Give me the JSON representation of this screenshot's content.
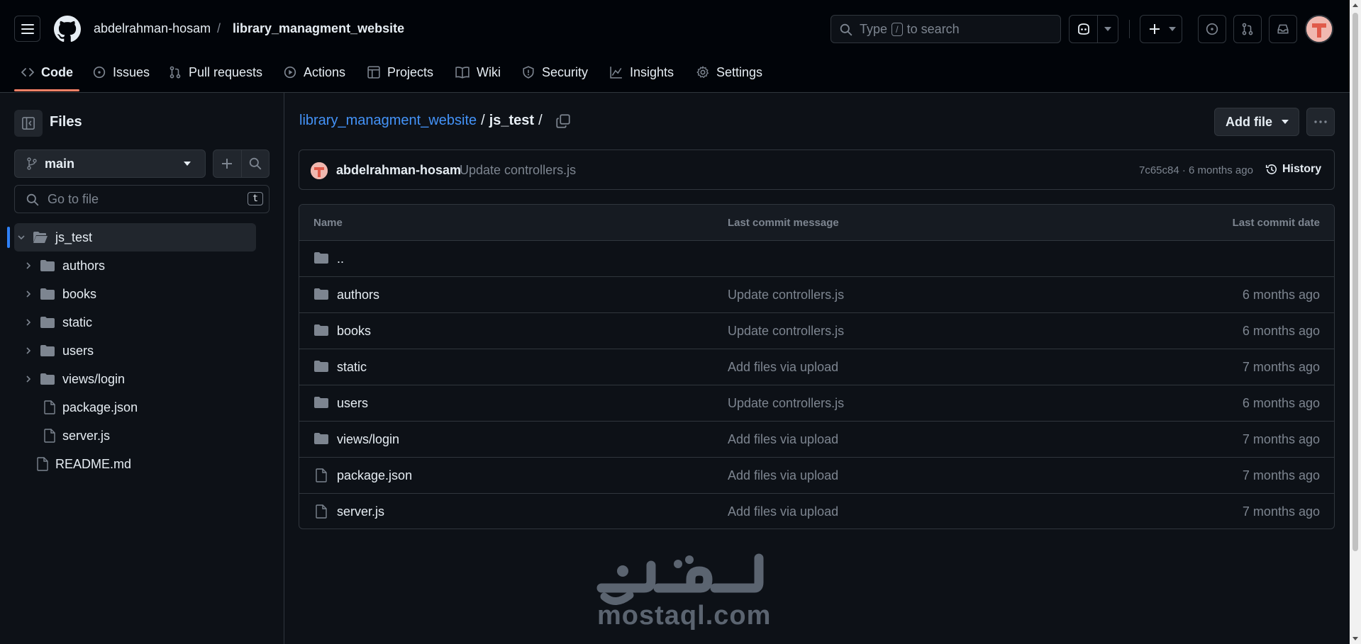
{
  "header": {
    "repo_owner": "abdelrahman-hosam",
    "repo_separator": "/",
    "repo_name": "library_managment_website",
    "search": {
      "prefix": "Type",
      "slash": "/",
      "suffix": "to search"
    },
    "icons": [
      "hamburger-icon",
      "github-logo-icon",
      "search-icon",
      "copilot-icon",
      "plus-icon",
      "issue-icon",
      "pull-request-icon",
      "inbox-icon"
    ]
  },
  "tabs": [
    {
      "label": "Code",
      "icon": "code-icon",
      "active": true
    },
    {
      "label": "Issues",
      "icon": "issue-icon"
    },
    {
      "label": "Pull requests",
      "icon": "pull-request-icon"
    },
    {
      "label": "Actions",
      "icon": "play-icon"
    },
    {
      "label": "Projects",
      "icon": "table-icon"
    },
    {
      "label": "Wiki",
      "icon": "book-icon"
    },
    {
      "label": "Security",
      "icon": "shield-icon"
    },
    {
      "label": "Insights",
      "icon": "graph-icon"
    },
    {
      "label": "Settings",
      "icon": "gear-icon"
    }
  ],
  "sidebar": {
    "title": "Files",
    "branch": "main",
    "goto_placeholder": "Go to file",
    "goto_shortcut": "t",
    "tree": [
      {
        "label": "js_test",
        "type": "folder-open",
        "expanded": true,
        "selected": true
      },
      {
        "label": "authors",
        "type": "folder"
      },
      {
        "label": "books",
        "type": "folder"
      },
      {
        "label": "static",
        "type": "folder"
      },
      {
        "label": "users",
        "type": "folder"
      },
      {
        "label": "views/login",
        "type": "folder"
      },
      {
        "label": "package.json",
        "type": "file"
      },
      {
        "label": "server.js",
        "type": "file"
      },
      {
        "label": "README.md",
        "type": "file"
      }
    ]
  },
  "main": {
    "breadcrumb": {
      "repo": "library_managment_website",
      "sep1": "/",
      "current": "js_test",
      "sep2": "/"
    },
    "add_file_label": "Add file",
    "commit": {
      "author": "abdelrahman-hosam",
      "message": "Update controllers.js",
      "meta": "7c65c84 · 6 months ago",
      "history_label": "History"
    },
    "table": {
      "headers": {
        "name": "Name",
        "message": "Last commit message",
        "date": "Last commit date"
      },
      "parent_row": "..",
      "rows": [
        {
          "name": "authors",
          "type": "folder",
          "message": "Update controllers.js",
          "date": "6 months ago"
        },
        {
          "name": "books",
          "type": "folder",
          "message": "Update controllers.js",
          "date": "6 months ago"
        },
        {
          "name": "static",
          "type": "folder",
          "message": "Add files via upload",
          "date": "7 months ago"
        },
        {
          "name": "users",
          "type": "folder",
          "message": "Update controllers.js",
          "date": "6 months ago"
        },
        {
          "name": "views/login",
          "type": "folder",
          "message": "Add files via upload",
          "date": "7 months ago"
        },
        {
          "name": "package.json",
          "type": "file",
          "message": "Add files via upload",
          "date": "7 months ago"
        },
        {
          "name": "server.js",
          "type": "file",
          "message": "Add files via upload",
          "date": "7 months ago"
        }
      ]
    }
  },
  "watermark": {
    "arabic": "مستقل",
    "latin": "mostaql.com"
  },
  "colors": {
    "background": "#0d1117",
    "header_bg": "#010409",
    "border": "#30363d",
    "link": "#4493f8",
    "muted": "#7d8590",
    "accent_underline": "#f78166",
    "selected_bar": "#2f81f7"
  }
}
